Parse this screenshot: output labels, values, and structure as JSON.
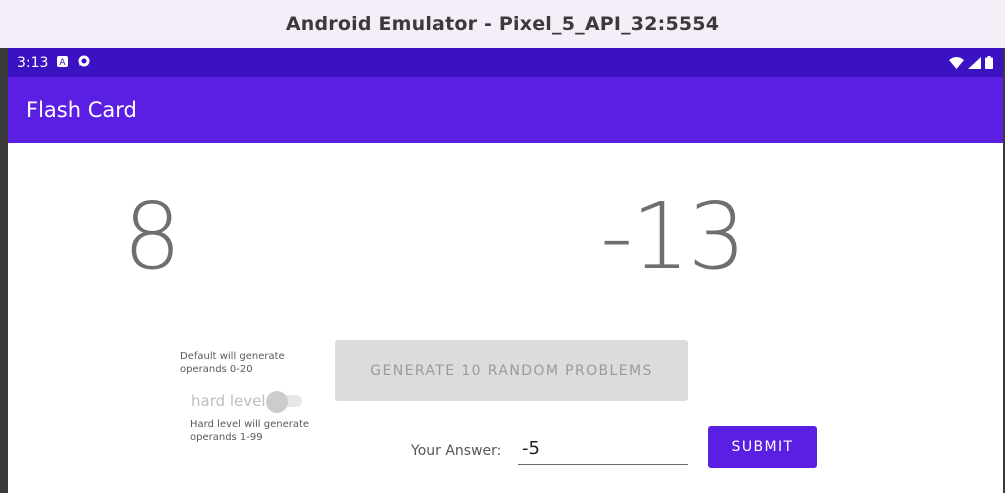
{
  "window": {
    "title": "Android Emulator - Pixel_5_API_32:5554"
  },
  "statusbar": {
    "time": "3:13",
    "icons": [
      "app-notification-icon",
      "chat-notification-icon",
      "wifi-icon",
      "signal-icon",
      "battery-icon"
    ]
  },
  "appbar": {
    "title": "Flash Card"
  },
  "problem": {
    "operand1": "8",
    "operand2": "-13"
  },
  "help": {
    "default_text": "Default will generate operands 0-20",
    "hard_text": "Hard level will generate operands 1-99"
  },
  "toggle": {
    "label": "hard level",
    "checked": false
  },
  "generate_button": {
    "label": "GENERATE 10 RANDOM PROBLEMS",
    "enabled": false
  },
  "answer": {
    "label": "Your Answer:",
    "value": "-5"
  },
  "submit_button": {
    "label": "SUBMIT"
  },
  "colors": {
    "status_bar": "#3b12c2",
    "app_bar": "#5b1fe3",
    "accent": "#5b1fe3",
    "window_title_bg": "#f5eef8"
  }
}
